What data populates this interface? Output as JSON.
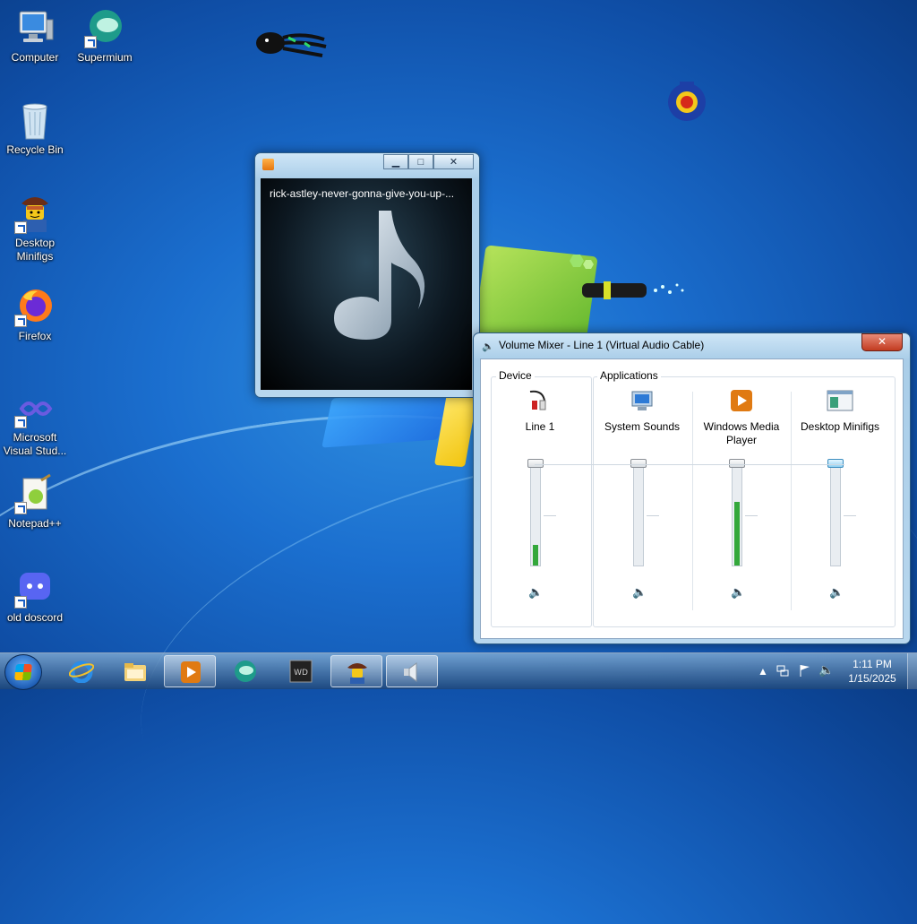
{
  "desktop": {
    "icons": [
      {
        "label": "Computer",
        "icon": "computer-icon"
      },
      {
        "label": "Supermium",
        "icon": "supermium-icon"
      },
      {
        "label": "Recycle Bin",
        "icon": "recycle-bin-icon"
      },
      {
        "label": "Desktop Minifigs",
        "icon": "minifig-icon"
      },
      {
        "label": "Firefox",
        "icon": "firefox-icon"
      },
      {
        "label": "Microsoft Visual Stud...",
        "icon": "visual-studio-icon"
      },
      {
        "label": "Notepad++",
        "icon": "notepadpp-icon"
      },
      {
        "label": "old doscord",
        "icon": "discord-icon"
      }
    ]
  },
  "media_player": {
    "now_playing": "rick-astley-never-gonna-give-you-up-...",
    "buttons": {
      "minimize": "▁",
      "maximize": "□",
      "close": "✕"
    }
  },
  "volume_mixer": {
    "title": "Volume Mixer - Line 1 (Virtual Audio Cable)",
    "close": "✕",
    "device_group_label": "Device",
    "applications_group_label": "Applications",
    "channels": [
      {
        "name": "Line 1",
        "level": 0.2,
        "volume": 1.0
      },
      {
        "name": "System Sounds",
        "level": 0.0,
        "volume": 1.0
      },
      {
        "name": "Windows Media Player",
        "level": 0.63,
        "volume": 1.0
      },
      {
        "name": "Desktop Minifigs",
        "level": 0.0,
        "volume": 1.0
      }
    ]
  },
  "taskbar": {
    "pinned": [
      "start-orb",
      "internet-explorer",
      "file-explorer",
      "windows-media-player",
      "supermium",
      "wd-sd",
      "desktop-minifigs",
      "volume-mixer"
    ],
    "clock_time": "1:11 PM",
    "clock_date": "1/15/2025"
  },
  "colors": {
    "accent": "#1f6fd0",
    "meter_green": "#34a83b",
    "close_red": "#c23b20"
  }
}
